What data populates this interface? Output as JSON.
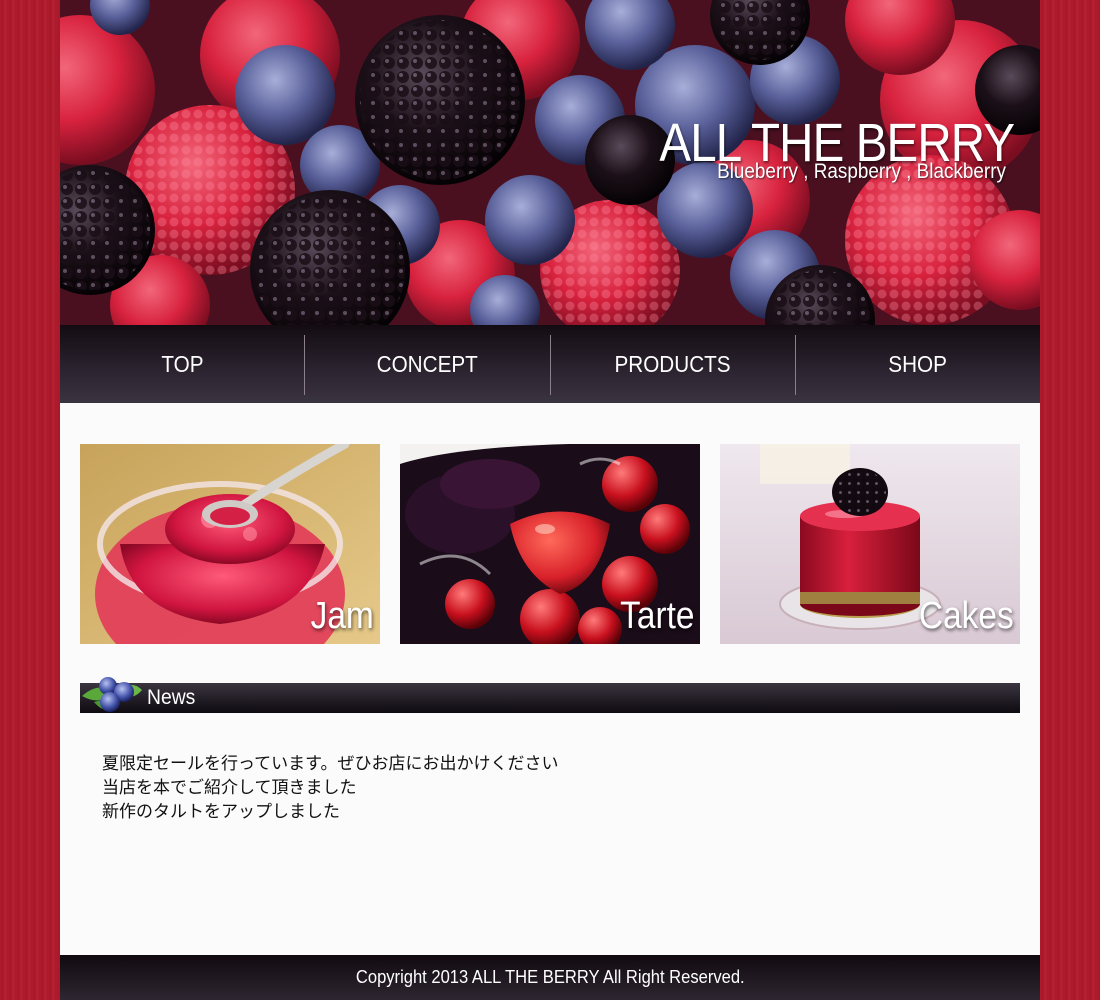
{
  "header": {
    "title": "ALL THE BERRY",
    "subtitle": "Blueberry , Raspberry , Blackberry"
  },
  "nav": {
    "items": [
      {
        "label": "TOP"
      },
      {
        "label": "CONCEPT"
      },
      {
        "label": "PRODUCTS"
      },
      {
        "label": "SHOP"
      }
    ]
  },
  "categories": [
    {
      "label": "Jam"
    },
    {
      "label": "Tarte"
    },
    {
      "label": "Cakes"
    }
  ],
  "news": {
    "heading": "News",
    "items": [
      "夏限定セールを行っています。ぜひお店にお出かけください",
      "当店を本でご紹介して頂きました",
      "新作のタルトをアップしました"
    ]
  },
  "footer": {
    "copyright": "Copyright 2013 ALL THE BERRY All Right Reserved."
  },
  "colors": {
    "background": "#b01c2e",
    "nav": "#2c2430",
    "page": "#fbfbfb"
  }
}
